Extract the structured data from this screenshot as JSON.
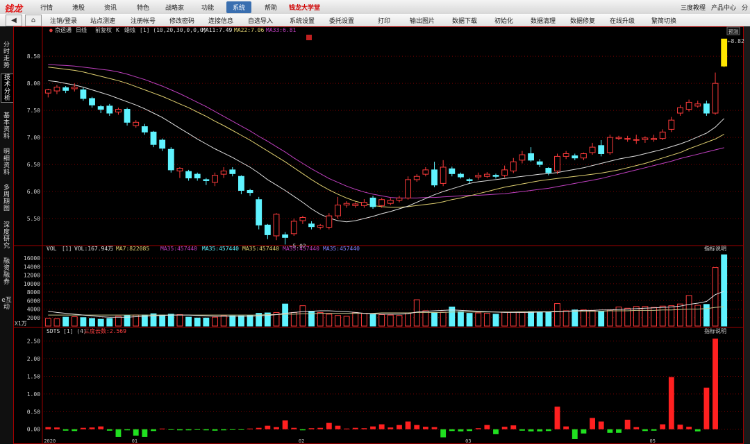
{
  "app": {
    "logo": "钱龙"
  },
  "menu": {
    "items": [
      "行情",
      "港股",
      "资讯",
      "特色",
      "战略家",
      "功能",
      "系统",
      "帮助"
    ],
    "active": "系统",
    "highlight": "钱龙大学堂",
    "right": [
      "三度教程",
      "产品中心",
      "分"
    ]
  },
  "toolbar": {
    "items": [
      "注销/登录",
      "站点测速",
      "注册帐号",
      "修改密码",
      "连接信息",
      "自选导入",
      "系统设置",
      "委托设置",
      "打印",
      "输出图片",
      "数据下载",
      "初始化",
      "数据清理",
      "数据修复",
      "在线升级",
      "繁简切换"
    ]
  },
  "sidebar": {
    "tabs": [
      "分时走势",
      "技术分析",
      "基本资料",
      "明细资料",
      "多周期图",
      "深度研究",
      "融资融券",
      "e互动"
    ],
    "active": "技术分析"
  },
  "price_header": {
    "name": "京运通",
    "period": "日线",
    "adjust": "前复权",
    "kline": "K",
    "style": "蜡烛",
    "params": "[1] (10,20,30,0,0,0)",
    "ma1": "MA11:7.49",
    "ma2": "MA22:7.06",
    "ma3": "MA33:6.81",
    "mode": "预测",
    "low_note": "5.02",
    "high_note": "8.82"
  },
  "vol_header": {
    "text": "VOL",
    "params": "[1]",
    "vol": "VOL:167.94万",
    "ma": "MA7:822085",
    "extra": "MA35:457440",
    "unit": "X1万"
  },
  "sdts_header": {
    "text": "SDTS",
    "params": "[1] (4)",
    "value": "三度云数:2.569"
  },
  "indicator_label": "指标说明",
  "colors": {
    "up": "#ff3b3b",
    "down": "#5ff3ff",
    "ma1": "#e0e0e0",
    "ma2": "#e0d070",
    "ma3": "#c040c0",
    "grid": "#7a0000",
    "panel_border": "#a00000"
  },
  "chart_data": [
    {
      "type": "candlestick",
      "ylim": [
        5.0,
        8.9
      ],
      "yticks": [
        5.5,
        6.0,
        6.5,
        7.0,
        7.5,
        8.0,
        8.5
      ],
      "x_ticks": [
        "2020",
        "01",
        "02",
        "03",
        "05"
      ],
      "candles": [
        [
          7.82,
          7.88,
          7.74,
          7.9
        ],
        [
          7.86,
          7.93,
          7.8,
          7.97
        ],
        [
          7.92,
          7.87,
          7.82,
          7.95
        ],
        [
          7.9,
          7.93,
          7.85,
          8.0
        ],
        [
          7.88,
          7.72,
          7.68,
          7.92
        ],
        [
          7.72,
          7.6,
          7.55,
          7.75
        ],
        [
          7.57,
          7.52,
          7.45,
          7.6
        ],
        [
          7.58,
          7.45,
          7.4,
          7.62
        ],
        [
          7.47,
          7.52,
          7.42,
          7.55
        ],
        [
          7.52,
          7.28,
          7.22,
          7.55
        ],
        [
          7.22,
          7.28,
          7.18,
          7.32
        ],
        [
          7.2,
          7.1,
          7.05,
          7.25
        ],
        [
          7.1,
          6.87,
          6.82,
          7.12
        ],
        [
          6.95,
          6.8,
          6.75,
          6.98
        ],
        [
          6.78,
          6.4,
          6.35,
          6.82
        ],
        [
          6.38,
          6.43,
          6.25,
          6.45
        ],
        [
          6.37,
          6.25,
          6.2,
          6.4
        ],
        [
          6.32,
          6.25,
          6.2,
          6.35
        ],
        [
          6.22,
          6.2,
          6.12,
          6.25
        ],
        [
          6.17,
          6.3,
          6.1,
          6.35
        ],
        [
          6.32,
          6.38,
          6.25,
          6.45
        ],
        [
          6.4,
          6.33,
          6.28,
          6.45
        ],
        [
          6.28,
          6.02,
          5.95,
          6.3
        ],
        [
          6.02,
          5.98,
          5.92,
          6.05
        ],
        [
          5.85,
          5.38,
          5.3,
          5.9
        ],
        [
          5.38,
          5.2,
          5.12,
          5.4
        ],
        [
          5.18,
          5.58,
          5.1,
          5.6
        ],
        [
          5.2,
          5.15,
          5.02,
          5.25
        ],
        [
          5.22,
          5.45,
          5.18,
          5.5
        ],
        [
          5.46,
          5.52,
          5.4,
          5.55
        ],
        [
          5.4,
          5.35,
          5.3,
          5.45
        ],
        [
          5.34,
          5.37,
          5.3,
          5.4
        ],
        [
          5.34,
          5.55,
          5.3,
          5.6
        ],
        [
          5.55,
          5.75,
          5.5,
          5.9
        ],
        [
          5.75,
          5.78,
          5.7,
          5.82
        ],
        [
          5.74,
          5.77,
          5.7,
          5.8
        ],
        [
          5.74,
          5.8,
          5.7,
          5.86
        ],
        [
          5.88,
          5.72,
          5.68,
          5.92
        ],
        [
          5.74,
          5.85,
          5.7,
          5.88
        ],
        [
          5.78,
          5.84,
          5.75,
          5.88
        ],
        [
          5.84,
          5.88,
          5.8,
          5.92
        ],
        [
          5.88,
          6.22,
          5.85,
          6.28
        ],
        [
          6.22,
          6.28,
          6.18,
          6.32
        ],
        [
          6.32,
          6.4,
          6.28,
          6.45
        ],
        [
          6.4,
          6.12,
          6.08,
          6.55
        ],
        [
          6.15,
          6.45,
          6.1,
          6.58
        ],
        [
          6.42,
          6.33,
          6.28,
          6.46
        ],
        [
          6.32,
          6.27,
          6.24,
          6.35
        ],
        [
          6.22,
          6.2,
          6.15,
          6.25
        ],
        [
          6.27,
          6.3,
          6.22,
          6.35
        ],
        [
          6.28,
          6.32,
          6.25,
          6.36
        ],
        [
          6.3,
          6.28,
          6.24,
          6.33
        ],
        [
          6.3,
          6.4,
          6.26,
          6.48
        ],
        [
          6.38,
          6.55,
          6.34,
          6.62
        ],
        [
          6.58,
          6.68,
          6.52,
          6.75
        ],
        [
          6.7,
          6.58,
          6.55,
          6.82
        ],
        [
          6.55,
          6.5,
          6.45,
          6.6
        ],
        [
          6.43,
          6.35,
          6.3,
          6.45
        ],
        [
          6.38,
          6.65,
          6.32,
          6.7
        ],
        [
          6.65,
          6.7,
          6.6,
          6.75
        ],
        [
          6.66,
          6.62,
          6.58,
          6.7
        ],
        [
          6.62,
          6.7,
          6.58,
          6.72
        ],
        [
          6.72,
          6.82,
          6.68,
          6.9
        ],
        [
          6.85,
          6.7,
          6.65,
          6.95
        ],
        [
          6.72,
          7.0,
          6.68,
          7.05
        ],
        [
          6.98,
          7.0,
          6.95,
          7.03
        ],
        [
          6.97,
          6.98,
          6.92,
          7.03
        ],
        [
          6.95,
          6.96,
          6.88,
          7.05
        ],
        [
          6.96,
          6.99,
          6.9,
          7.02
        ],
        [
          6.96,
          6.98,
          6.92,
          7.05
        ],
        [
          6.98,
          7.1,
          6.95,
          7.15
        ],
        [
          7.15,
          7.32,
          7.1,
          7.38
        ],
        [
          7.45,
          7.55,
          7.4,
          7.6
        ],
        [
          7.52,
          7.65,
          7.48,
          7.7
        ],
        [
          7.58,
          7.62,
          7.55,
          7.68
        ],
        [
          7.62,
          7.45,
          7.4,
          7.68
        ],
        [
          7.45,
          8.0,
          7.42,
          8.2
        ],
        [
          8.82,
          8.32,
          8.3,
          8.82
        ]
      ],
      "ma11": [
        8.05,
        8.03,
        8.0,
        7.97,
        7.93,
        7.88,
        7.83,
        7.78,
        7.72,
        7.66,
        7.6,
        7.53,
        7.45,
        7.37,
        7.27,
        7.17,
        7.07,
        6.97,
        6.88,
        6.79,
        6.71,
        6.63,
        6.54,
        6.45,
        6.34,
        6.22,
        6.12,
        6.02,
        5.91,
        5.8,
        5.68,
        5.58,
        5.51,
        5.46,
        5.44,
        5.46,
        5.5,
        5.54,
        5.59,
        5.63,
        5.68,
        5.73,
        5.8,
        5.87,
        5.94,
        6.0,
        6.05,
        6.1,
        6.15,
        6.18,
        6.2,
        6.22,
        6.24,
        6.26,
        6.28,
        6.3,
        6.32,
        6.33,
        6.35,
        6.38,
        6.41,
        6.44,
        6.48,
        6.52,
        6.56,
        6.6,
        6.63,
        6.66,
        6.7,
        6.74,
        6.78,
        6.83,
        6.88,
        6.94,
        7.01,
        7.08,
        7.19,
        7.35
      ],
      "ma22": [
        8.3,
        8.28,
        8.26,
        8.24,
        8.21,
        8.17,
        8.13,
        8.09,
        8.05,
        8.0,
        7.94,
        7.88,
        7.82,
        7.76,
        7.69,
        7.62,
        7.55,
        7.47,
        7.39,
        7.3,
        7.22,
        7.13,
        7.04,
        6.95,
        6.85,
        6.75,
        6.65,
        6.55,
        6.44,
        6.33,
        6.22,
        6.12,
        6.03,
        5.95,
        5.88,
        5.82,
        5.78,
        5.74,
        5.72,
        5.71,
        5.71,
        5.72,
        5.74,
        5.76,
        5.78,
        5.81,
        5.85,
        5.88,
        5.92,
        5.96,
        6.0,
        6.04,
        6.08,
        6.11,
        6.14,
        6.17,
        6.2,
        6.22,
        6.24,
        6.26,
        6.28,
        6.3,
        6.32,
        6.34,
        6.37,
        6.4,
        6.44,
        6.48,
        6.52,
        6.57,
        6.62,
        6.67,
        6.72,
        6.79,
        6.85,
        6.91,
        6.97,
        7.06
      ],
      "ma33": [
        8.35,
        8.34,
        8.33,
        8.32,
        8.3,
        8.28,
        8.26,
        8.24,
        8.21,
        8.17,
        8.12,
        8.07,
        8.01,
        7.95,
        7.88,
        7.81,
        7.73,
        7.65,
        7.57,
        7.48,
        7.39,
        7.3,
        7.21,
        7.12,
        7.02,
        6.93,
        6.83,
        6.73,
        6.62,
        6.52,
        6.42,
        6.33,
        6.24,
        6.17,
        6.1,
        6.04,
        5.99,
        5.95,
        5.92,
        5.89,
        5.88,
        5.88,
        5.88,
        5.89,
        5.89,
        5.9,
        5.91,
        5.92,
        5.93,
        5.93,
        5.94,
        5.95,
        5.96,
        5.98,
        6.0,
        6.02,
        6.04,
        6.06,
        6.09,
        6.12,
        6.15,
        6.18,
        6.21,
        6.24,
        6.28,
        6.32,
        6.36,
        6.4,
        6.44,
        6.48,
        6.52,
        6.56,
        6.61,
        6.65,
        6.69,
        6.73,
        6.77,
        6.81
      ]
    },
    {
      "type": "bar",
      "name": "VOL",
      "ylim": [
        0,
        17000
      ],
      "yticks": [
        2000,
        4000,
        6000,
        8000,
        10000,
        12000,
        14000,
        16000
      ],
      "values": [
        1800,
        1700,
        2100,
        2200,
        2000,
        1800,
        1600,
        1800,
        2300,
        2500,
        2600,
        2600,
        2900,
        2600,
        2800,
        2700,
        2100,
        1900,
        1900,
        2100,
        2500,
        2400,
        2400,
        2500,
        3000,
        3100,
        3200,
        5200,
        3200,
        4800,
        3500,
        3200,
        2800,
        2500,
        2300,
        3200,
        3000,
        2700,
        2700,
        2600,
        2500,
        3100,
        6200,
        3600,
        3200,
        3300,
        4500,
        3400,
        3000,
        3100,
        3000,
        2800,
        3300,
        3300,
        3200,
        3400,
        3300,
        3300,
        5300,
        3600,
        3800,
        3800,
        3600,
        3500,
        3800,
        4500,
        4200,
        4600,
        4600,
        4400,
        4700,
        4800,
        5200,
        7200,
        4900,
        5100,
        13800,
        16800
      ],
      "ma7": [
        3500,
        3200,
        3000,
        2800,
        2600,
        2400,
        2200,
        2100,
        2100,
        2100,
        2200,
        2300,
        2400,
        2500,
        2600,
        2600,
        2600,
        2500,
        2400,
        2300,
        2300,
        2300,
        2300,
        2300,
        2400,
        2500,
        2700,
        3000,
        3200,
        3400,
        3500,
        3600,
        3600,
        3500,
        3400,
        3200,
        3000,
        2900,
        2800,
        2800,
        2800,
        2900,
        3300,
        3500,
        3600,
        3700,
        3800,
        3700,
        3600,
        3500,
        3400,
        3300,
        3200,
        3200,
        3200,
        3200,
        3300,
        3300,
        3400,
        3500,
        3600,
        3700,
        3700,
        3800,
        3800,
        3900,
        4000,
        4100,
        4200,
        4300,
        4400,
        4500,
        4700,
        5100,
        5400,
        5800,
        7400,
        8200
      ],
      "ma35": [
        2600,
        2600,
        2600,
        2600,
        2600,
        2600,
        2600,
        2600,
        2600,
        2600,
        2600,
        2600,
        2600,
        2600,
        2600,
        2600,
        2600,
        2600,
        2600,
        2600,
        2600,
        2600,
        2600,
        2600,
        2600,
        2700,
        2700,
        2800,
        2800,
        2900,
        2900,
        3000,
        3000,
        3000,
        3000,
        3000,
        3000,
        3000,
        3100,
        3100,
        3100,
        3100,
        3200,
        3200,
        3200,
        3200,
        3300,
        3300,
        3300,
        3300,
        3300,
        3300,
        3300,
        3300,
        3400,
        3400,
        3400,
        3400,
        3500,
        3500,
        3500,
        3500,
        3500,
        3500,
        3600,
        3600,
        3600,
        3700,
        3700,
        3700,
        3800,
        3800,
        3900,
        4000,
        4000,
        4100,
        4400,
        4574
      ]
    },
    {
      "type": "bar",
      "name": "SDTS",
      "ylim": [
        -0.3,
        2.65
      ],
      "yticks": [
        0.0,
        0.5,
        1.0,
        1.5,
        2.0,
        2.5
      ],
      "values": [
        0.06,
        0.05,
        -0.04,
        -0.05,
        0.04,
        0.05,
        0.08,
        -0.04,
        -0.22,
        -0.03,
        -0.18,
        -0.22,
        -0.05,
        0.02,
        -0.02,
        -0.03,
        -0.03,
        -0.02,
        -0.03,
        -0.04,
        -0.03,
        -0.02,
        -0.02,
        0.02,
        0.04,
        0.1,
        0.06,
        0.25,
        0.04,
        -0.03,
        0.03,
        0.04,
        0.18,
        0.1,
        0.02,
        0.04,
        0.03,
        0.08,
        0.14,
        0.05,
        0.12,
        0.22,
        0.12,
        0.07,
        0.06,
        -0.23,
        -0.05,
        -0.06,
        -0.05,
        0.03,
        0.12,
        -0.14,
        0.07,
        0.11,
        -0.04,
        -0.06,
        -0.06,
        -0.05,
        0.64,
        0.08,
        -0.28,
        -0.12,
        0.32,
        0.22,
        -0.1,
        -0.1,
        0.27,
        0.06,
        -0.05,
        -0.04,
        0.14,
        1.48,
        0.13,
        0.07,
        -0.06,
        1.18,
        2.569
      ]
    }
  ]
}
